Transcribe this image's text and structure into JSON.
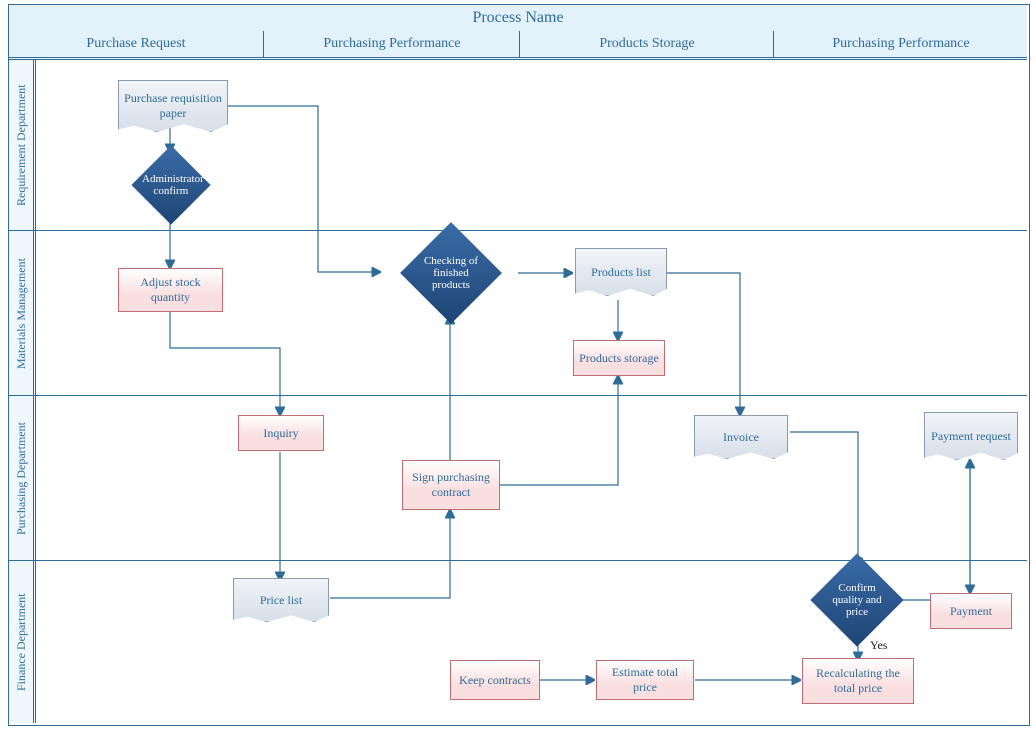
{
  "title": "Process Name",
  "columns": {
    "c1": "Purchase Request",
    "c2": "Purchasing Performance",
    "c3": "Products Storage",
    "c4": "Purchasing Performance"
  },
  "lanes": {
    "l1": "Requirement Department",
    "l2": "Materials Management",
    "l3": "Purchasing Department",
    "l4": "Finance Department"
  },
  "nodes": {
    "purchase_req_paper": "Purchase requisition paper",
    "admin_confirm": "Administrator confirm",
    "adjust_stock": "Adjust stock quantity",
    "checking_finished": "Checking of finished products",
    "products_list": "Products list",
    "products_storage": "Products storage",
    "inquiry": "Inquiry",
    "sign_contract": "Sign purchasing contract",
    "invoice": "Invoice",
    "payment_request": "Payment request",
    "price_list": "Price list",
    "keep_contracts": "Keep contracts",
    "estimate_total": "Estimate total price",
    "recalculating": "Recalculating the total price",
    "confirm_qp": "Confirm quality and price",
    "payment": "Payment"
  },
  "labels": {
    "yes": "Yes"
  },
  "chart_data": {
    "type": "swimlane-flowchart",
    "title": "Process Name",
    "columns": [
      "Purchase Request",
      "Purchasing Performance",
      "Products Storage",
      "Purchasing Performance"
    ],
    "lanes": [
      "Requirement Department",
      "Materials Management",
      "Purchasing Department",
      "Finance Department"
    ],
    "nodes": [
      {
        "id": "purchase_req_paper",
        "shape": "document",
        "lane": "Requirement Department",
        "column": "Purchase Request",
        "label": "Purchase requisition paper"
      },
      {
        "id": "admin_confirm",
        "shape": "decision",
        "lane": "Requirement Department",
        "column": "Purchase Request",
        "label": "Administrator confirm"
      },
      {
        "id": "adjust_stock",
        "shape": "process",
        "lane": "Materials Management",
        "column": "Purchase Request",
        "label": "Adjust stock quantity"
      },
      {
        "id": "checking_finished",
        "shape": "decision",
        "lane": "Materials Management",
        "column": "Purchasing Performance",
        "label": "Checking of finished products"
      },
      {
        "id": "products_list",
        "shape": "document",
        "lane": "Materials Management",
        "column": "Products Storage",
        "label": "Products list"
      },
      {
        "id": "products_storage",
        "shape": "process",
        "lane": "Materials Management",
        "column": "Products Storage",
        "label": "Products storage"
      },
      {
        "id": "inquiry",
        "shape": "process",
        "lane": "Purchasing Department",
        "column": "Purchase Request",
        "label": "Inquiry"
      },
      {
        "id": "sign_contract",
        "shape": "process",
        "lane": "Purchasing Department",
        "column": "Purchasing Performance",
        "label": "Sign purchasing contract"
      },
      {
        "id": "invoice",
        "shape": "document",
        "lane": "Purchasing Department",
        "column": "Products Storage",
        "label": "Invoice"
      },
      {
        "id": "payment_request",
        "shape": "document",
        "lane": "Purchasing Department",
        "column": "Purchasing Performance",
        "label": "Payment request"
      },
      {
        "id": "price_list",
        "shape": "document",
        "lane": "Finance Department",
        "column": "Purchase Request",
        "label": "Price list"
      },
      {
        "id": "keep_contracts",
        "shape": "process",
        "lane": "Finance Department",
        "column": "Purchasing Performance",
        "label": "Keep contracts"
      },
      {
        "id": "estimate_total",
        "shape": "process",
        "lane": "Finance Department",
        "column": "Products Storage",
        "label": "Estimate total price"
      },
      {
        "id": "recalculating",
        "shape": "process",
        "lane": "Finance Department",
        "column": "Purchasing Performance",
        "label": "Recalculating the total price"
      },
      {
        "id": "confirm_qp",
        "shape": "decision",
        "lane": "Finance Department",
        "column": "Purchasing Performance",
        "label": "Confirm quality and price"
      },
      {
        "id": "payment",
        "shape": "process",
        "lane": "Finance Department",
        "column": "Purchasing Performance",
        "label": "Payment"
      }
    ],
    "edges": [
      {
        "from": "purchase_req_paper",
        "to": "admin_confirm"
      },
      {
        "from": "purchase_req_paper",
        "to": "checking_finished"
      },
      {
        "from": "admin_confirm",
        "to": "adjust_stock"
      },
      {
        "from": "adjust_stock",
        "to": "inquiry"
      },
      {
        "from": "inquiry",
        "to": "price_list"
      },
      {
        "from": "price_list",
        "to": "sign_contract"
      },
      {
        "from": "sign_contract",
        "to": "checking_finished"
      },
      {
        "from": "sign_contract",
        "to": "products_storage"
      },
      {
        "from": "checking_finished",
        "to": "products_list"
      },
      {
        "from": "products_list",
        "to": "products_storage"
      },
      {
        "from": "products_list",
        "to": "invoice"
      },
      {
        "from": "invoice",
        "to": "confirm_qp"
      },
      {
        "from": "confirm_qp",
        "to": "recalculating",
        "label": "Yes"
      },
      {
        "from": "confirm_qp",
        "to": "payment_request"
      },
      {
        "from": "payment_request",
        "to": "payment"
      },
      {
        "from": "keep_contracts",
        "to": "estimate_total"
      },
      {
        "from": "estimate_total",
        "to": "recalculating"
      }
    ]
  }
}
